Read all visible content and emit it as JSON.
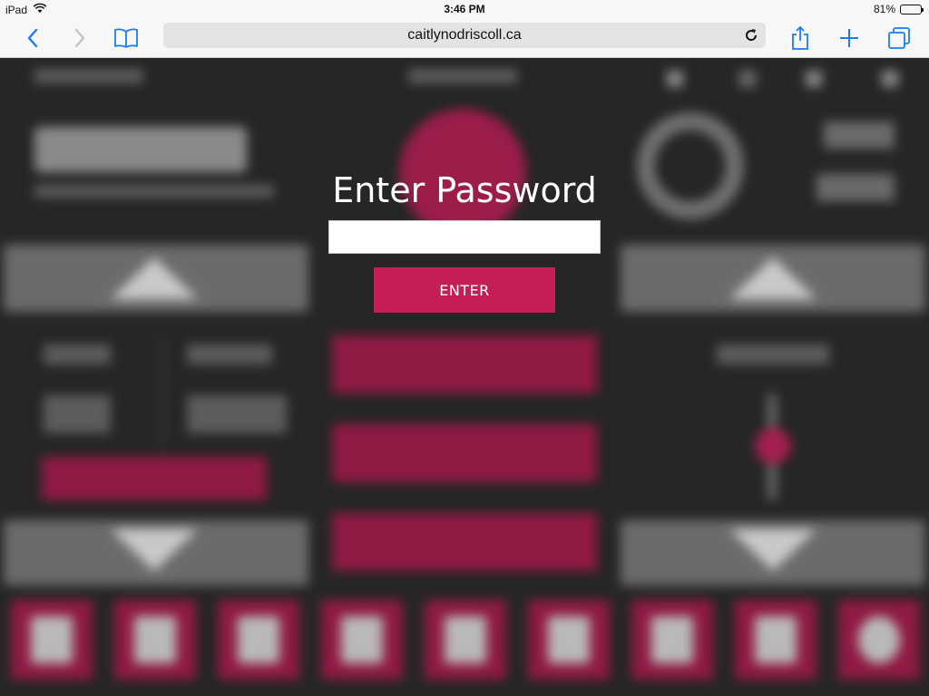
{
  "status_bar": {
    "device": "iPad",
    "time": "3:46 PM",
    "battery": "81%",
    "battery_level": 0.81
  },
  "browser": {
    "url": "caitlynodriscoll.ca",
    "icons": {
      "back": "chevron-left-icon",
      "forward": "chevron-right-icon",
      "bookmarks": "book-icon",
      "reload": "reload-icon",
      "share": "share-icon",
      "new_tab": "plus-icon",
      "tabs": "tabs-icon"
    }
  },
  "password_dialog": {
    "title": "Enter Password",
    "input_value": "",
    "button_label": "ENTER"
  },
  "background_app": {
    "blurred": true,
    "icons": [
      "lock-icon",
      "home-icon",
      "pills-icon",
      "food-icon",
      "note-icon",
      "phone-icon",
      "calculator-icon",
      "calendar-icon",
      "settings-icon"
    ]
  },
  "colors": {
    "accent": "#c41d57",
    "background": "#262626",
    "toolbar_tint": "#1a7cf5"
  }
}
